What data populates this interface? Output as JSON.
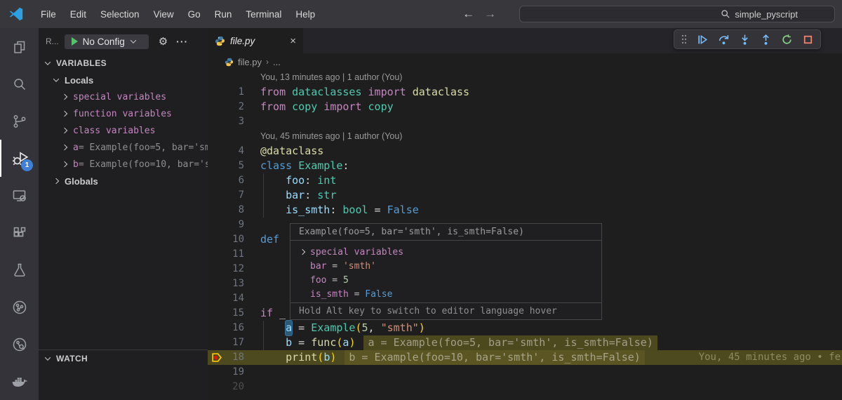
{
  "titlebar": {
    "menus": [
      "File",
      "Edit",
      "Selection",
      "View",
      "Go",
      "Run",
      "Terminal",
      "Help"
    ],
    "search_text": "simple_pyscript",
    "nav": {
      "back": "←",
      "forward": "→"
    }
  },
  "activity_bar": {
    "items": [
      "explorer",
      "search",
      "source-control",
      "run-and-debug",
      "remote-explorer",
      "extensions",
      "testing",
      "git-graph",
      "code-inspect",
      "docker"
    ],
    "active_item": "run-and-debug",
    "badge": "1"
  },
  "sidebar": {
    "title_truncated": "R...",
    "config_label": "No Config",
    "gear_icon": "⚙",
    "more_icon": "···",
    "tree": [
      {
        "label": "VARIABLES",
        "kind": "header",
        "chev": "down",
        "indent": 0
      },
      {
        "label": "Locals",
        "kind": "scope",
        "chev": "down",
        "indent": 1
      },
      {
        "label": "special variables",
        "kind": "special",
        "chev": "right",
        "indent": 2
      },
      {
        "label": "function variables",
        "kind": "special",
        "chev": "right",
        "indent": 2
      },
      {
        "label": "class variables",
        "kind": "special",
        "chev": "right",
        "indent": 2
      },
      {
        "name": "a",
        "value": "= Example(foo=5, bar='sm…",
        "kind": "var",
        "chev": "right",
        "indent": 2
      },
      {
        "name": "b",
        "value": "= Example(foo=10, bar='s…",
        "kind": "var",
        "chev": "right",
        "indent": 2
      },
      {
        "label": "Globals",
        "kind": "scope",
        "chev": "right",
        "indent": 1
      }
    ],
    "watch_label": "WATCH"
  },
  "debug_toolbar": {
    "buttons": [
      "drag-handle",
      "continue",
      "step-over",
      "step-into",
      "step-out",
      "restart",
      "stop"
    ]
  },
  "editor": {
    "tab_label": "file.py",
    "tab_close": "×",
    "breadcrumb": [
      "file.py",
      "..."
    ],
    "rows": [
      {
        "lens": "You, 13 minutes ago | 1 author (You)"
      },
      {
        "n": "1",
        "tokens": [
          [
            "from ",
            "k1"
          ],
          [
            "dataclasses ",
            "ty"
          ],
          [
            "import ",
            "k1"
          ],
          [
            "dataclass",
            "fn"
          ]
        ]
      },
      {
        "n": "2",
        "tokens": [
          [
            "from ",
            "k1"
          ],
          [
            "copy ",
            "ty"
          ],
          [
            "import ",
            "k1"
          ],
          [
            "copy",
            "ty"
          ]
        ]
      },
      {
        "n": "3",
        "tokens": []
      },
      {
        "lens": "You, 45 minutes ago | 1 author (You)"
      },
      {
        "n": "4",
        "tokens": [
          [
            "@dataclass",
            "fn"
          ]
        ]
      },
      {
        "n": "5",
        "tokens": [
          [
            "class ",
            "k2"
          ],
          [
            "Example",
            "ty"
          ],
          [
            ":",
            "pl"
          ]
        ]
      },
      {
        "n": "6",
        "guide": true,
        "tokens": [
          [
            "    ",
            "pl"
          ],
          [
            "foo",
            "vr"
          ],
          [
            ": ",
            "pl"
          ],
          [
            "int",
            "ty"
          ]
        ]
      },
      {
        "n": "7",
        "guide": true,
        "tokens": [
          [
            "    ",
            "pl"
          ],
          [
            "bar",
            "vr"
          ],
          [
            ": ",
            "pl"
          ],
          [
            "str",
            "ty"
          ]
        ]
      },
      {
        "n": "8",
        "guide": true,
        "tokens": [
          [
            "    ",
            "pl"
          ],
          [
            "is_smth",
            "vr"
          ],
          [
            ": ",
            "pl"
          ],
          [
            "bool",
            "ty"
          ],
          [
            " = ",
            "pl"
          ],
          [
            "False",
            "k2"
          ]
        ]
      },
      {
        "n": "9",
        "tokens": []
      },
      {
        "n": "10",
        "tokens": [
          [
            "def ",
            "k2"
          ]
        ]
      },
      {
        "n": "11",
        "tokens": []
      },
      {
        "n": "12",
        "tokens": []
      },
      {
        "n": "13",
        "tokens": []
      },
      {
        "n": "14",
        "tokens": []
      },
      {
        "n": "15",
        "tokens": [
          [
            "if ",
            "k1"
          ],
          [
            "_",
            "pl"
          ]
        ]
      },
      {
        "n": "16",
        "guide": true,
        "tokens": [
          [
            "    ",
            "pl"
          ],
          [
            "a",
            "vr hl"
          ],
          [
            " = ",
            "pl"
          ],
          [
            "Example",
            "ty"
          ],
          [
            "(",
            "br"
          ],
          [
            "5",
            "nu"
          ],
          [
            ", ",
            "pl"
          ],
          [
            "\"smth\"",
            "st"
          ],
          [
            ")",
            "br"
          ]
        ]
      },
      {
        "n": "17",
        "guide": true,
        "tokens": [
          [
            "    ",
            "pl"
          ],
          [
            "b",
            "vr"
          ],
          [
            " = ",
            "pl"
          ],
          [
            "func",
            "fn"
          ],
          [
            "(",
            "br"
          ],
          [
            "a",
            "vr"
          ],
          [
            ")",
            "br"
          ]
        ],
        "chip": "a = Example(foo=5, bar='smth', is_smth=False)"
      },
      {
        "n": "18",
        "current": true,
        "arrow": true,
        "tokens": [
          [
            "    ",
            "pl"
          ],
          [
            "print",
            "fn"
          ],
          [
            "(",
            "br"
          ],
          [
            "b",
            "vr"
          ],
          [
            ")",
            "br"
          ]
        ],
        "chip": "b = Example(foo=10, bar='smth', is_smth=False)",
        "blame": "You, 45 minutes ago • fe"
      },
      {
        "n": "19",
        "tokens": []
      },
      {
        "n": "20",
        "dim": true,
        "tokens": []
      }
    ]
  },
  "tooltip": {
    "header": "Example(foo=5, bar='smth', is_smth=False)",
    "rows": [
      {
        "expand": true,
        "tokens": [
          [
            "special variables",
            "k1"
          ]
        ]
      },
      {
        "tokens": [
          [
            "bar",
            "k1"
          ],
          [
            " = ",
            "pl2"
          ],
          [
            "'smth'",
            "st"
          ]
        ]
      },
      {
        "tokens": [
          [
            "foo",
            "k1"
          ],
          [
            " = ",
            "pl2"
          ],
          [
            "5",
            "nu"
          ]
        ]
      },
      {
        "tokens": [
          [
            "is_smth",
            "k1"
          ],
          [
            " = ",
            "pl2"
          ],
          [
            "False",
            "k2"
          ]
        ]
      }
    ],
    "footer": "Hold Alt key to switch to editor language hover"
  },
  "colors": {
    "keyword_magenta": "#C586C0",
    "keyword_blue": "#569CD6",
    "type_teal": "#4EC9B0",
    "function_yellow": "#DCDCAA",
    "variable_blue": "#9CDCFE",
    "number_green": "#B5CEA8",
    "string_orange": "#CE9178",
    "bracket_gold": "#FFD700",
    "current_line_bg": "#4E4A1F",
    "badge_blue": "#3F7FD4",
    "debug_blue": "#75BEFF",
    "restart_green": "#89D185",
    "stop_red": "#F48771"
  }
}
